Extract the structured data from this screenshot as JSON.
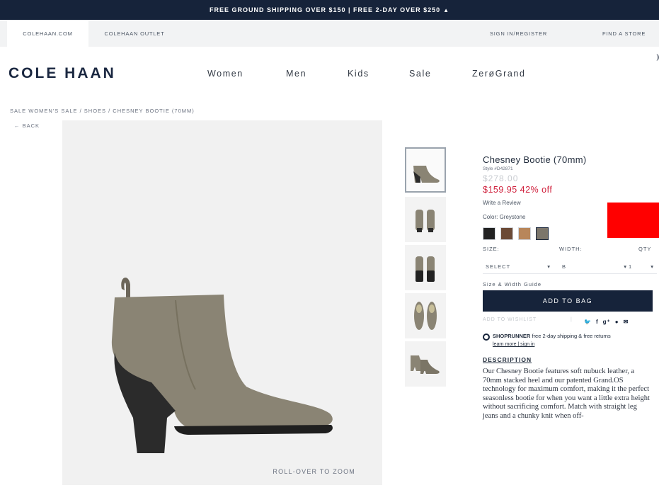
{
  "promo": {
    "text": "FREE GROUND SHIPPING OVER $150 | FREE 2-DAY OVER $250",
    "chevron": "▲"
  },
  "utility": {
    "tab_main": "COLEHAAN.COM",
    "tab_outlet": "COLEHAAN OUTLET",
    "signin": "SIGN IN/REGISTER",
    "store": "FIND A STORE"
  },
  "header": {
    "logo": "COLE HAAN",
    "nav": [
      "Women",
      "Men",
      "Kids",
      "Sale",
      "ZerøGrand"
    ]
  },
  "breadcrumb": "SALE WOMEN'S SALE / SHOES / CHESNEY BOOTIE (70MM)",
  "back": "← BACK",
  "image": {
    "zoom_hint": "ROLL-OVER TO ZOOM"
  },
  "product": {
    "title": "Chesney Bootie (70mm)",
    "style": "Style #D42871",
    "original_price": "$278.00",
    "sale_price": "$159.95 42% off",
    "review": "Write a Review",
    "color_label": "Color: Greystone",
    "swatches": [
      "#222222",
      "#6b4a36",
      "#b8865a",
      "#7c766b"
    ],
    "size_label": "SIZE:",
    "width_label": "WIDTH:",
    "qty_label": "QTY",
    "size_value": "SELECT",
    "width_value": "B",
    "qty_value": "1",
    "size_guide": "Size & Width Guide",
    "add_to_bag": "ADD TO BAG",
    "wishlist": "ADD TO WISHLIST",
    "shoprunner_brand": "SHOPRUNNER",
    "shoprunner_text": "free 2-day shipping & free returns",
    "shoprunner_links": "learn more | sign in",
    "desc_heading": "DESCRIPTION",
    "description": "Our Chesney Bootie features soft nubuck leather, a 70mm stacked heel and our patented Grand.OS technology for maximum comfort, making it the perfect seasonless bootie for when you want a little extra height without sacrificing comfort. Match with straight leg jeans and a chunky knit when off-"
  },
  "colors": {
    "navy": "#16233a",
    "sale_red": "#d0213d",
    "ad_red": "#ff0000"
  }
}
